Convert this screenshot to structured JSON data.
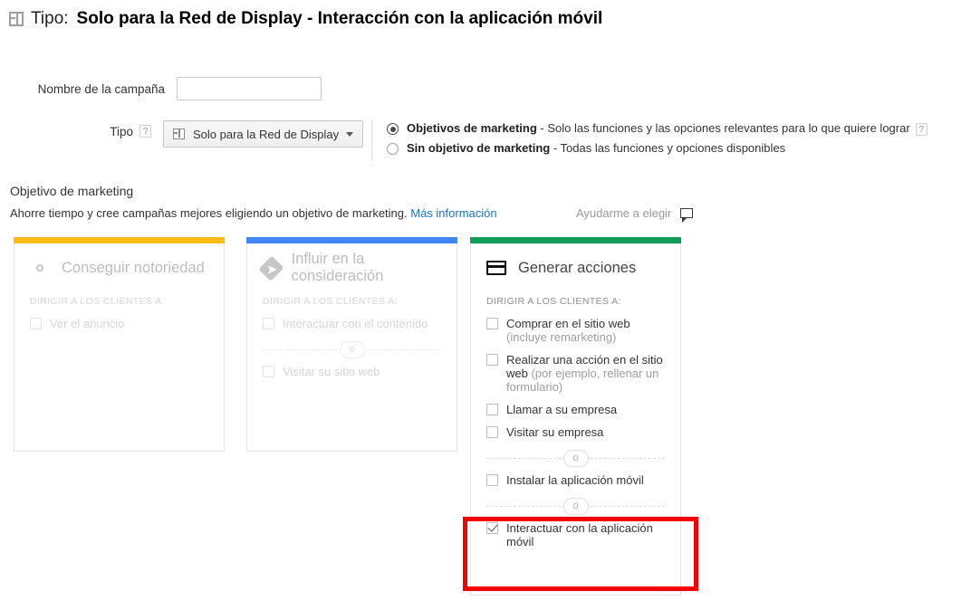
{
  "header": {
    "icon": "display-layout-icon",
    "label": "Tipo:",
    "title": "Solo para la Red de Display - Interacción con la aplicación móvil"
  },
  "form": {
    "campaign_name": {
      "label": "Nombre de la campaña",
      "value": "",
      "placeholder": ""
    },
    "type": {
      "label": "Tipo",
      "help": "?",
      "icon": "display-layout-icon",
      "selected": "Solo para la Red de Display",
      "caret": "chevron-down-icon"
    },
    "radios": [
      {
        "selected": true,
        "strong": "Objetivos de marketing",
        "rest": " - Solo las funciones y las opciones relevantes para lo que quiere lograr",
        "help": "?"
      },
      {
        "selected": false,
        "strong": "Sin objetivo de marketing",
        "rest": " - Todas las funciones y opciones disponibles",
        "help": ""
      }
    ]
  },
  "section": {
    "title": "Objetivo de marketing",
    "subtitle": "Ahorre tiempo y cree campañas mejores eligiendo un objetivo de marketing.",
    "more_link": "Más información",
    "help_choose": "Ayudarme a elegir",
    "help_choose_icon": "speech-bubble-icon"
  },
  "cards": [
    {
      "id": "awareness",
      "stripe_color": "#F9BC15",
      "icon": "eye-icon",
      "title": "Conseguir notoriedad",
      "state": "disabled",
      "target_label": "DIRIGIR A LOS CLIENTES A:",
      "options": [
        {
          "checked": false,
          "text": "Ver el anuncio",
          "muted": ""
        }
      ]
    },
    {
      "id": "consideration",
      "stripe_color": "#4285F4",
      "icon": "diamond-arrow-icon",
      "title": "Influir en la consideración",
      "state": "disabled",
      "target_label": "DIRIGIR A LOS CLIENTES A:",
      "options": [
        {
          "checked": false,
          "text": "Interactuar con el contenido",
          "muted": ""
        },
        {
          "separator": "o"
        },
        {
          "checked": false,
          "text": "Visitar su sitio web",
          "muted": ""
        }
      ]
    },
    {
      "id": "actions",
      "stripe_color": "#0F9D58",
      "icon": "credit-card-icon",
      "title": "Generar acciones",
      "state": "active",
      "target_label": "DIRIGIR A LOS CLIENTES A:",
      "options": [
        {
          "checked": false,
          "text": "Comprar en el sitio web ",
          "muted": "(incluye remarketing)"
        },
        {
          "checked": false,
          "text": "Realizar una acción en el sitio web ",
          "muted": "(por ejemplo, rellenar un formulario)"
        },
        {
          "checked": false,
          "text": "Llamar a su empresa",
          "muted": ""
        },
        {
          "checked": false,
          "text": "Visitar su empresa",
          "muted": ""
        },
        {
          "separator": "o"
        },
        {
          "checked": false,
          "text": "Instalar la aplicación móvil",
          "muted": ""
        },
        {
          "separator": "o"
        },
        {
          "checked": true,
          "text": "Interactuar con la aplicación móvil",
          "muted": ""
        }
      ]
    }
  ],
  "highlight": {
    "color": "#f40000",
    "target": "Interactuar con la aplicación móvil"
  }
}
